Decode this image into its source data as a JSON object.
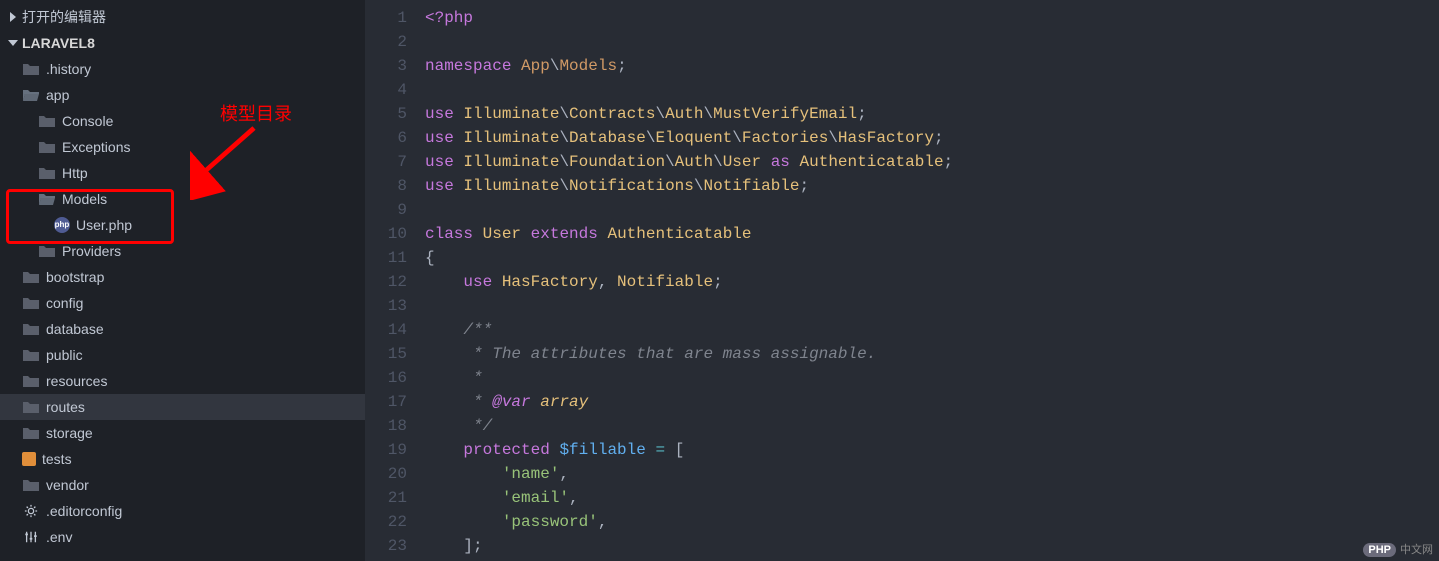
{
  "explorer": {
    "open_editors_label": "打开的编辑器",
    "project_name": "LARAVEL8",
    "items": [
      {
        "name": ".history",
        "kind": "folder",
        "depth": 1,
        "open": false
      },
      {
        "name": "app",
        "kind": "folder",
        "depth": 1,
        "open": true
      },
      {
        "name": "Console",
        "kind": "folder",
        "depth": 2,
        "open": false
      },
      {
        "name": "Exceptions",
        "kind": "folder",
        "depth": 2,
        "open": false
      },
      {
        "name": "Http",
        "kind": "folder",
        "depth": 2,
        "open": false
      },
      {
        "name": "Models",
        "kind": "folder",
        "depth": 2,
        "open": true
      },
      {
        "name": "User.php",
        "kind": "php",
        "depth": 3,
        "active": false
      },
      {
        "name": "Providers",
        "kind": "folder",
        "depth": 2,
        "open": false
      },
      {
        "name": "bootstrap",
        "kind": "folder",
        "depth": 1,
        "open": false
      },
      {
        "name": "config",
        "kind": "folder",
        "depth": 1,
        "open": false
      },
      {
        "name": "database",
        "kind": "folder",
        "depth": 1,
        "open": false
      },
      {
        "name": "public",
        "kind": "folder",
        "depth": 1,
        "open": false
      },
      {
        "name": "resources",
        "kind": "folder",
        "depth": 1,
        "open": false
      },
      {
        "name": "routes",
        "kind": "folder",
        "depth": 1,
        "open": false,
        "active": true
      },
      {
        "name": "storage",
        "kind": "folder",
        "depth": 1,
        "open": false
      },
      {
        "name": "tests",
        "kind": "tests",
        "depth": 1
      },
      {
        "name": "vendor",
        "kind": "folder",
        "depth": 1,
        "open": false
      },
      {
        "name": ".editorconfig",
        "kind": "editorconfig",
        "depth": 1
      },
      {
        "name": ".env",
        "kind": "env",
        "depth": 1
      }
    ]
  },
  "annotation": {
    "label": "模型目录"
  },
  "code": {
    "lines": [
      [
        {
          "c": "tk-tag",
          "t": "<?php"
        }
      ],
      [],
      [
        {
          "c": "tk-kw",
          "t": "namespace"
        },
        {
          "c": "tk-plain",
          "t": " "
        },
        {
          "c": "tk-ns",
          "t": "App"
        },
        {
          "c": "tk-punc",
          "t": "\\"
        },
        {
          "c": "tk-ns",
          "t": "Models"
        },
        {
          "c": "tk-punc",
          "t": ";"
        }
      ],
      [],
      [
        {
          "c": "tk-kw",
          "t": "use"
        },
        {
          "c": "tk-plain",
          "t": " "
        },
        {
          "c": "tk-ns2",
          "t": "Illuminate"
        },
        {
          "c": "tk-punc",
          "t": "\\"
        },
        {
          "c": "tk-ns2",
          "t": "Contracts"
        },
        {
          "c": "tk-punc",
          "t": "\\"
        },
        {
          "c": "tk-ns2",
          "t": "Auth"
        },
        {
          "c": "tk-punc",
          "t": "\\"
        },
        {
          "c": "tk-ns2",
          "t": "MustVerifyEmail"
        },
        {
          "c": "tk-punc",
          "t": ";"
        }
      ],
      [
        {
          "c": "tk-kw",
          "t": "use"
        },
        {
          "c": "tk-plain",
          "t": " "
        },
        {
          "c": "tk-ns2",
          "t": "Illuminate"
        },
        {
          "c": "tk-punc",
          "t": "\\"
        },
        {
          "c": "tk-ns2",
          "t": "Database"
        },
        {
          "c": "tk-punc",
          "t": "\\"
        },
        {
          "c": "tk-ns2",
          "t": "Eloquent"
        },
        {
          "c": "tk-punc",
          "t": "\\"
        },
        {
          "c": "tk-ns2",
          "t": "Factories"
        },
        {
          "c": "tk-punc",
          "t": "\\"
        },
        {
          "c": "tk-ns2",
          "t": "HasFactory"
        },
        {
          "c": "tk-punc",
          "t": ";"
        }
      ],
      [
        {
          "c": "tk-kw",
          "t": "use"
        },
        {
          "c": "tk-plain",
          "t": " "
        },
        {
          "c": "tk-ns2",
          "t": "Illuminate"
        },
        {
          "c": "tk-punc",
          "t": "\\"
        },
        {
          "c": "tk-ns2",
          "t": "Foundation"
        },
        {
          "c": "tk-punc",
          "t": "\\"
        },
        {
          "c": "tk-ns2",
          "t": "Auth"
        },
        {
          "c": "tk-punc",
          "t": "\\"
        },
        {
          "c": "tk-ns2",
          "t": "User"
        },
        {
          "c": "tk-plain",
          "t": " "
        },
        {
          "c": "tk-kw",
          "t": "as"
        },
        {
          "c": "tk-plain",
          "t": " "
        },
        {
          "c": "tk-ns2",
          "t": "Authenticatable"
        },
        {
          "c": "tk-punc",
          "t": ";"
        }
      ],
      [
        {
          "c": "tk-kw",
          "t": "use"
        },
        {
          "c": "tk-plain",
          "t": " "
        },
        {
          "c": "tk-ns2",
          "t": "Illuminate"
        },
        {
          "c": "tk-punc",
          "t": "\\"
        },
        {
          "c": "tk-ns2",
          "t": "Notifications"
        },
        {
          "c": "tk-punc",
          "t": "\\"
        },
        {
          "c": "tk-ns2",
          "t": "Notifiable"
        },
        {
          "c": "tk-punc",
          "t": ";"
        }
      ],
      [],
      [
        {
          "c": "tk-kw",
          "t": "class"
        },
        {
          "c": "tk-plain",
          "t": " "
        },
        {
          "c": "tk-class",
          "t": "User"
        },
        {
          "c": "tk-plain",
          "t": " "
        },
        {
          "c": "tk-kw",
          "t": "extends"
        },
        {
          "c": "tk-plain",
          "t": " "
        },
        {
          "c": "tk-class",
          "t": "Authenticatable"
        }
      ],
      [
        {
          "c": "tk-punc",
          "t": "{"
        }
      ],
      [
        {
          "c": "tk-plain",
          "t": "    "
        },
        {
          "c": "tk-kw",
          "t": "use"
        },
        {
          "c": "tk-plain",
          "t": " "
        },
        {
          "c": "tk-class",
          "t": "HasFactory"
        },
        {
          "c": "tk-punc",
          "t": ", "
        },
        {
          "c": "tk-class",
          "t": "Notifiable"
        },
        {
          "c": "tk-punc",
          "t": ";"
        }
      ],
      [],
      [
        {
          "c": "tk-plain",
          "t": "    "
        },
        {
          "c": "tk-comm",
          "t": "/**"
        }
      ],
      [
        {
          "c": "tk-plain",
          "t": "     "
        },
        {
          "c": "tk-comm",
          "t": "* The attributes that are mass assignable."
        }
      ],
      [
        {
          "c": "tk-plain",
          "t": "     "
        },
        {
          "c": "tk-comm",
          "t": "*"
        }
      ],
      [
        {
          "c": "tk-plain",
          "t": "     "
        },
        {
          "c": "tk-comm",
          "t": "* "
        },
        {
          "c": "tk-doctag",
          "t": "@var"
        },
        {
          "c": "tk-comm",
          "t": " "
        },
        {
          "c": "tk-doctype",
          "t": "array"
        }
      ],
      [
        {
          "c": "tk-plain",
          "t": "     "
        },
        {
          "c": "tk-comm",
          "t": "*/"
        }
      ],
      [
        {
          "c": "tk-plain",
          "t": "    "
        },
        {
          "c": "tk-kw",
          "t": "protected"
        },
        {
          "c": "tk-plain",
          "t": " "
        },
        {
          "c": "tk-var",
          "t": "$fillable"
        },
        {
          "c": "tk-plain",
          "t": " "
        },
        {
          "c": "tk-op",
          "t": "="
        },
        {
          "c": "tk-plain",
          "t": " "
        },
        {
          "c": "tk-punc",
          "t": "["
        }
      ],
      [
        {
          "c": "tk-plain",
          "t": "        "
        },
        {
          "c": "tk-str",
          "t": "'name'"
        },
        {
          "c": "tk-punc",
          "t": ","
        }
      ],
      [
        {
          "c": "tk-plain",
          "t": "        "
        },
        {
          "c": "tk-str",
          "t": "'email'"
        },
        {
          "c": "tk-punc",
          "t": ","
        }
      ],
      [
        {
          "c": "tk-plain",
          "t": "        "
        },
        {
          "c": "tk-str",
          "t": "'password'"
        },
        {
          "c": "tk-punc",
          "t": ","
        }
      ],
      [
        {
          "c": "tk-plain",
          "t": "    "
        },
        {
          "c": "tk-punc",
          "t": "];"
        }
      ]
    ]
  },
  "watermark": {
    "php": "PHP",
    "text": "中文网"
  }
}
